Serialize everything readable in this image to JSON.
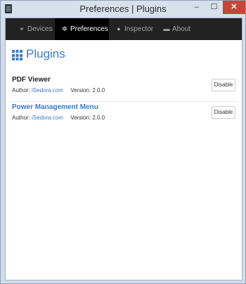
{
  "window": {
    "title": "Preferences | Plugins",
    "controls": {
      "minimize": "–",
      "maximize": "☐",
      "close": "✕"
    }
  },
  "nav": {
    "tabs": [
      {
        "label": "Devices",
        "icon": "link-icon",
        "active": false
      },
      {
        "label": "Preferences",
        "icon": "gear-icon",
        "active": true
      },
      {
        "label": "Inspector",
        "icon": "info-icon",
        "active": false
      },
      {
        "label": "About",
        "icon": "chat-bubble-icon",
        "active": false
      }
    ]
  },
  "page": {
    "heading": "Plugins",
    "heading_icon": "grid-icon"
  },
  "plugins": [
    {
      "name": "PDF Viewer",
      "author_label": "Author:",
      "author": "iSedora.com",
      "version_label": "Version:",
      "version": "2.0.0",
      "button": "Disable"
    },
    {
      "name": "Power Management Menu",
      "author_label": "Author:",
      "author": "iSedora.com",
      "version_label": "Version:",
      "version": "2.0.0",
      "button": "Disable"
    }
  ],
  "colors": {
    "accent": "#3a7bc8",
    "nav_bg": "#222222",
    "nav_active": "#000000",
    "close": "#c6463a"
  }
}
